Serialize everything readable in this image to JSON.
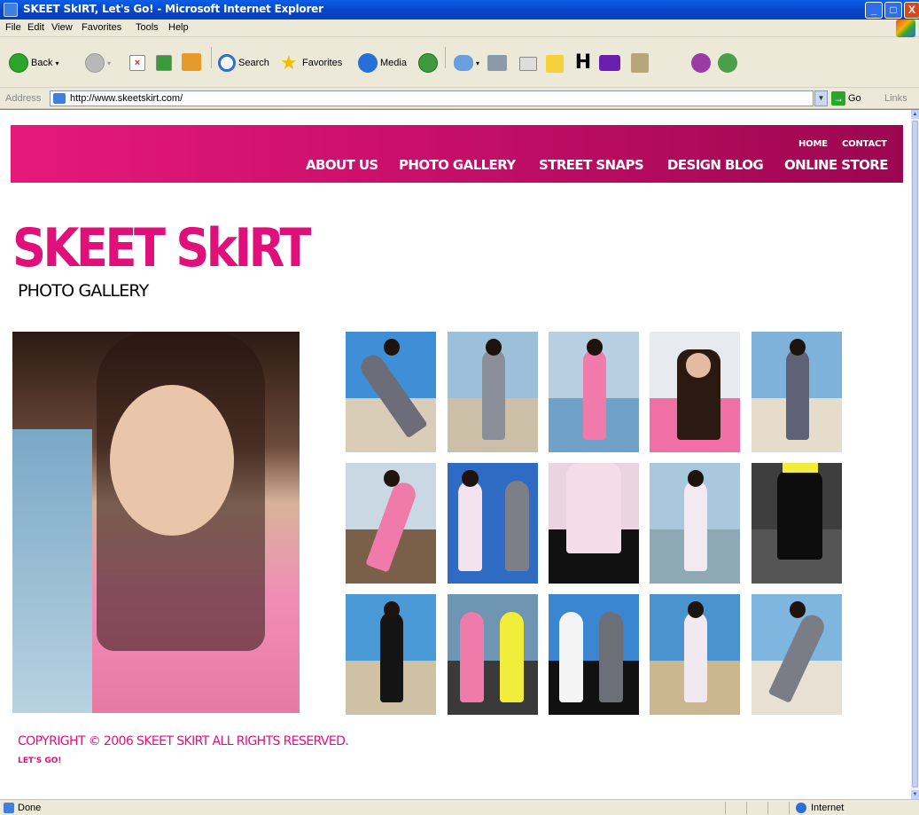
{
  "window": {
    "title": "SKEET SkIRT, Let's Go! - Microsoft Internet Explorer",
    "min_glyph": "_",
    "max_glyph": "□",
    "close_glyph": "X"
  },
  "menu": {
    "items": [
      "File",
      "Edit",
      "View",
      "Favorites",
      "Tools",
      "Help"
    ]
  },
  "toolbar": {
    "back": "Back",
    "search": "Search",
    "favorites": "Favorites",
    "media": "Media"
  },
  "address": {
    "label": "Address",
    "url": "http://www.skeetskirt.com/",
    "go": "Go",
    "links": "Links"
  },
  "site": {
    "nav_top": [
      "HOME",
      "CONTACT"
    ],
    "nav_main": [
      "ABOUT US",
      "PHOTO GALLERY",
      "STREET SNAPS",
      "DESIGN BLOG",
      "ONLINE STORE"
    ],
    "brand": "SKEET SkIRT",
    "heading": "PHOTO GALLERY",
    "copyright": "COPYRIGHT © 2006 SKEET SKIRT ALL RIGHTS RESERVED.",
    "tagline": "LET'S GO!",
    "accent_color": "#e0107a",
    "gallery_rows": 3,
    "gallery_cols": 5
  },
  "status": {
    "text": "Done",
    "zone": "Internet"
  }
}
